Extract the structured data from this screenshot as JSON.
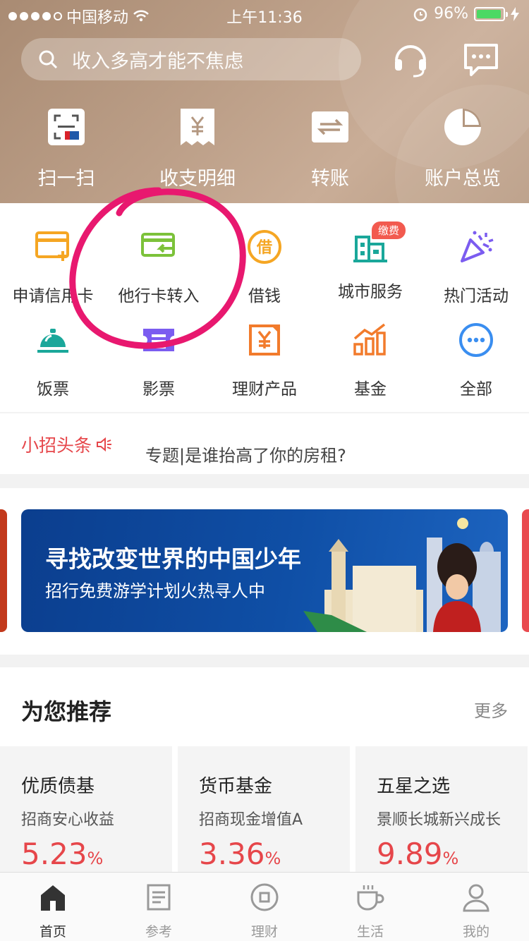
{
  "status_bar": {
    "carrier": "中国移动",
    "time": "上午11:36",
    "battery": "96%"
  },
  "search": {
    "placeholder": "收入多高才能不焦虑"
  },
  "quick_actions": [
    {
      "label": "扫一扫",
      "icon": "scan-icon"
    },
    {
      "label": "收支明细",
      "icon": "receipt-icon"
    },
    {
      "label": "转账",
      "icon": "transfer-icon"
    },
    {
      "label": "账户总览",
      "icon": "pie-chart-icon"
    }
  ],
  "services": [
    {
      "label": "申请信用卡",
      "icon": "credit-card-apply-icon"
    },
    {
      "label": "他行卡转入",
      "icon": "card-transfer-in-icon"
    },
    {
      "label": "借钱",
      "icon": "borrow-icon"
    },
    {
      "label": "城市服务",
      "icon": "city-service-icon",
      "badge": "缴费"
    },
    {
      "label": "热门活动",
      "icon": "party-popper-icon"
    },
    {
      "label": "饭票",
      "icon": "dining-bell-icon"
    },
    {
      "label": "影票",
      "icon": "ticket-icon"
    },
    {
      "label": "理财产品",
      "icon": "wealth-product-icon"
    },
    {
      "label": "基金",
      "icon": "fund-chart-icon"
    },
    {
      "label": "全部",
      "icon": "more-icon"
    }
  ],
  "news": {
    "tag": "小招头条",
    "headline": "专题|是谁抬高了你的房租?"
  },
  "banner": {
    "title": "寻找改变世界的中国少年",
    "subtitle": "招行免费游学计划火热寻人中"
  },
  "recommend": {
    "title": "为您推荐",
    "more": "更多",
    "cards": [
      {
        "name": "优质债基",
        "fund": "招商安心收益",
        "value": "5.23",
        "unit": "%"
      },
      {
        "name": "货币基金",
        "fund": "招商现金增值A",
        "value": "3.36",
        "unit": "%"
      },
      {
        "name": "五星之选",
        "fund": "景顺长城新兴成长",
        "value": "9.89",
        "unit": "%"
      }
    ]
  },
  "tabs": [
    {
      "label": "首页",
      "icon": "home-icon",
      "active": true
    },
    {
      "label": "参考",
      "icon": "document-icon"
    },
    {
      "label": "理财",
      "icon": "coin-icon"
    },
    {
      "label": "生活",
      "icon": "coffee-icon"
    },
    {
      "label": "我的",
      "icon": "user-icon"
    }
  ],
  "colors": {
    "header": "#b39780",
    "accent_red": "#e6464a",
    "orange": "#f5a623",
    "green": "#7cc23a",
    "teal": "#1aa79a",
    "purple": "#7b5cf0",
    "blue": "#3a8ef0"
  }
}
